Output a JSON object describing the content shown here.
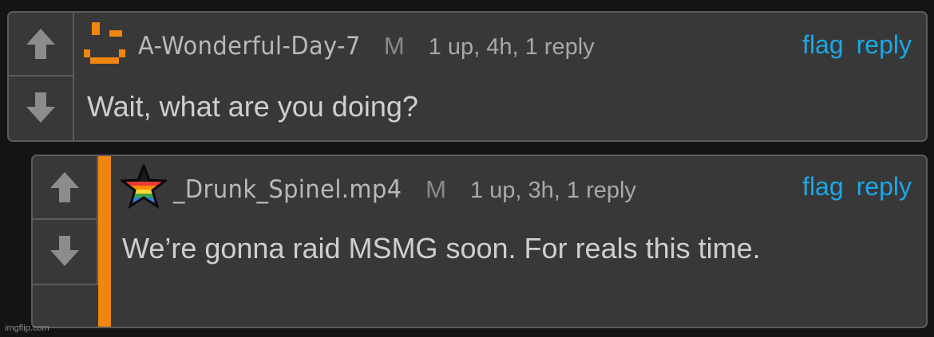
{
  "comments": [
    {
      "username": "A-Wonderful-Day-7",
      "badge": "M",
      "stats": "1 up, 4h, 1 reply",
      "flag_label": "flag",
      "reply_label": "reply",
      "body": "Wait, what are you doing?",
      "avatar_icon": "orange-pixel-smile-icon"
    },
    {
      "username": "_Drunk_Spinel.mp4",
      "badge": "M",
      "stats": "1 up, 3h, 1 reply",
      "flag_label": "flag",
      "reply_label": "reply",
      "body": "We’re gonna raid MSMG soon. For reals this time.",
      "avatar_icon": "rainbow-star-icon",
      "accent_color": "#f0850f"
    }
  ],
  "watermark": "imgflip.com",
  "colors": {
    "background": "#141414",
    "panel": "#383838",
    "border": "#5c5c5c",
    "link": "#1aa9e6",
    "accent": "#f0850f"
  }
}
